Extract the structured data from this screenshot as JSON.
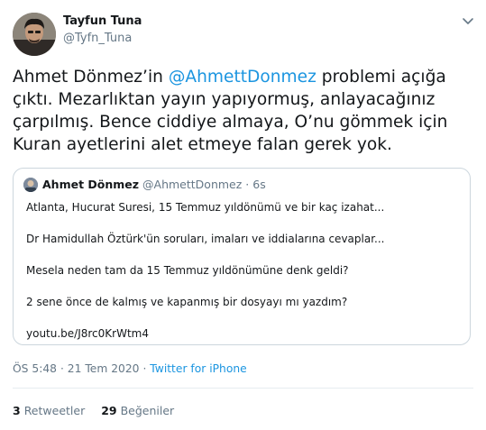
{
  "author": {
    "name": "Tayfun Tuna",
    "handle": "@Tyfn_Tuna"
  },
  "tweet": {
    "text_part1": "Ahmet Dönmez’in ",
    "mention": "@AhmettDonmez",
    "text_part2": " problemi açığa çıktı. Mezarlıktan yayın yapıyormuş, anlayacağınız çarpılmış. Bence ciddiye almaya, O’nu gömmek için Kuran ayetlerini alet etmeye falan gerek yok."
  },
  "quoted": {
    "name": "Ahmet Dönmez",
    "handle": "@AhmettDonmez",
    "separator": "·",
    "time": "6s",
    "lines": [
      "Atlanta, Hucurat Suresi, 15 Temmuz yıldönümü ve bir kaç izahat...",
      "Dr Hamidullah Öztürk'ün soruları, imaları ve iddialarına cevaplar...",
      "Mesela neden tam da 15 Temmuz yıldönümüne denk geldi?",
      "2 sene önce de kalmış ve kapanmış bir dosyayı mı yazdım?",
      "youtu.be/J8rc0KrWtm4"
    ]
  },
  "meta": {
    "time": "ÖS 5:48",
    "separator": "·",
    "date": "21 Tem 2020",
    "source_separator": "·",
    "source": "Twitter for iPhone"
  },
  "stats": {
    "retweets_count": "3",
    "retweets_label": "Retweetler",
    "likes_count": "29",
    "likes_label": "Beğeniler"
  },
  "icons": {
    "caret": "chevron-down-icon"
  },
  "colors": {
    "link": "#1b95e0",
    "secondary_text": "#657786",
    "border": "#ccd6dd"
  }
}
